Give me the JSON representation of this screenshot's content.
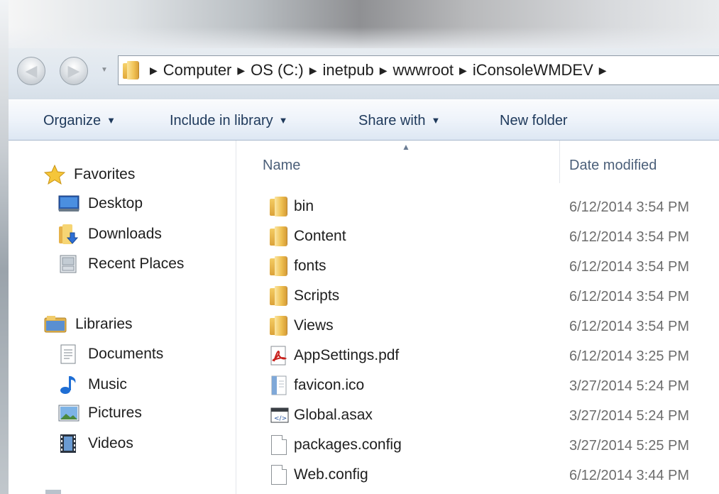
{
  "address": {
    "crumbs": [
      "Computer",
      "OS (C:)",
      "inetpub",
      "wwwroot",
      "iConsoleWMDEV"
    ]
  },
  "toolbar": {
    "organize": "Organize",
    "include_in_library": "Include in library",
    "share_with": "Share with",
    "new_folder": "New folder"
  },
  "nav": {
    "favorites": "Favorites",
    "desktop": "Desktop",
    "downloads": "Downloads",
    "recent_places": "Recent Places",
    "libraries": "Libraries",
    "documents": "Documents",
    "music": "Music",
    "pictures": "Pictures",
    "videos": "Videos"
  },
  "columns": {
    "name": "Name",
    "date_modified": "Date modified"
  },
  "files": [
    {
      "name": "bin",
      "date": "6/12/2014 3:54 PM",
      "icon": "folder-icon"
    },
    {
      "name": "Content",
      "date": "6/12/2014 3:54 PM",
      "icon": "folder-icon"
    },
    {
      "name": "fonts",
      "date": "6/12/2014 3:54 PM",
      "icon": "folder-icon"
    },
    {
      "name": "Scripts",
      "date": "6/12/2014 3:54 PM",
      "icon": "folder-icon"
    },
    {
      "name": "Views",
      "date": "6/12/2014 3:54 PM",
      "icon": "folder-icon"
    },
    {
      "name": "AppSettings.pdf",
      "date": "6/12/2014 3:25 PM",
      "icon": "pdf-icon"
    },
    {
      "name": "favicon.ico",
      "date": "3/27/2014 5:24 PM",
      "icon": "ico-file-icon"
    },
    {
      "name": "Global.asax",
      "date": "3/27/2014 5:24 PM",
      "icon": "asax-file-icon"
    },
    {
      "name": "packages.config",
      "date": "3/27/2014 5:25 PM",
      "icon": "config-file-icon"
    },
    {
      "name": "Web.config",
      "date": "6/12/2014 3:44 PM",
      "icon": "config-file-icon"
    }
  ]
}
